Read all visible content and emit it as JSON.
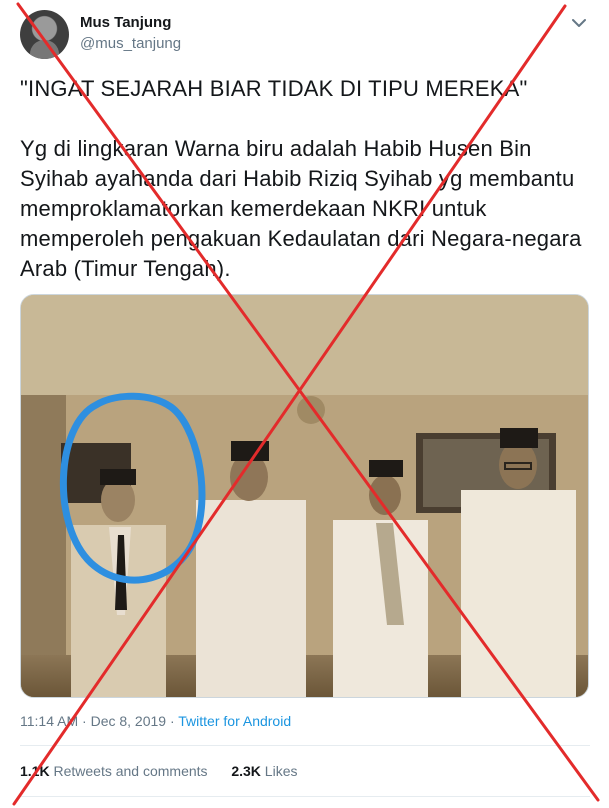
{
  "author": {
    "display_name": "Mus Tanjung",
    "handle": "@mus_tanjung"
  },
  "tweet": {
    "headline": "\"INGAT SEJARAH BIAR TIDAK DI TIPU MEREKA\"",
    "body": "Yg di lingkaran Warna biru adalah Habib Husen Bin Syihab ayahanda dari Habib Riziq Syihab yg membantu memproklamatorkan kemerdekaan NKRI untuk memperoleh pengakuan Kedaulatan dari Negara-negara Arab (Timur Tengah)."
  },
  "meta": {
    "time": "11:14 AM",
    "separator": "·",
    "date": "Dec 8, 2019",
    "source": "Twitter for Android"
  },
  "stats": {
    "retweets_count": "1.1K",
    "retweets_label": "Retweets and comments",
    "likes_count": "2.3K",
    "likes_label": "Likes"
  },
  "overlay": {
    "cross_color": "#e32b2b",
    "highlight_circle_color": "#2e8fe0"
  },
  "icons": {
    "caret": "chevron-down-icon"
  }
}
